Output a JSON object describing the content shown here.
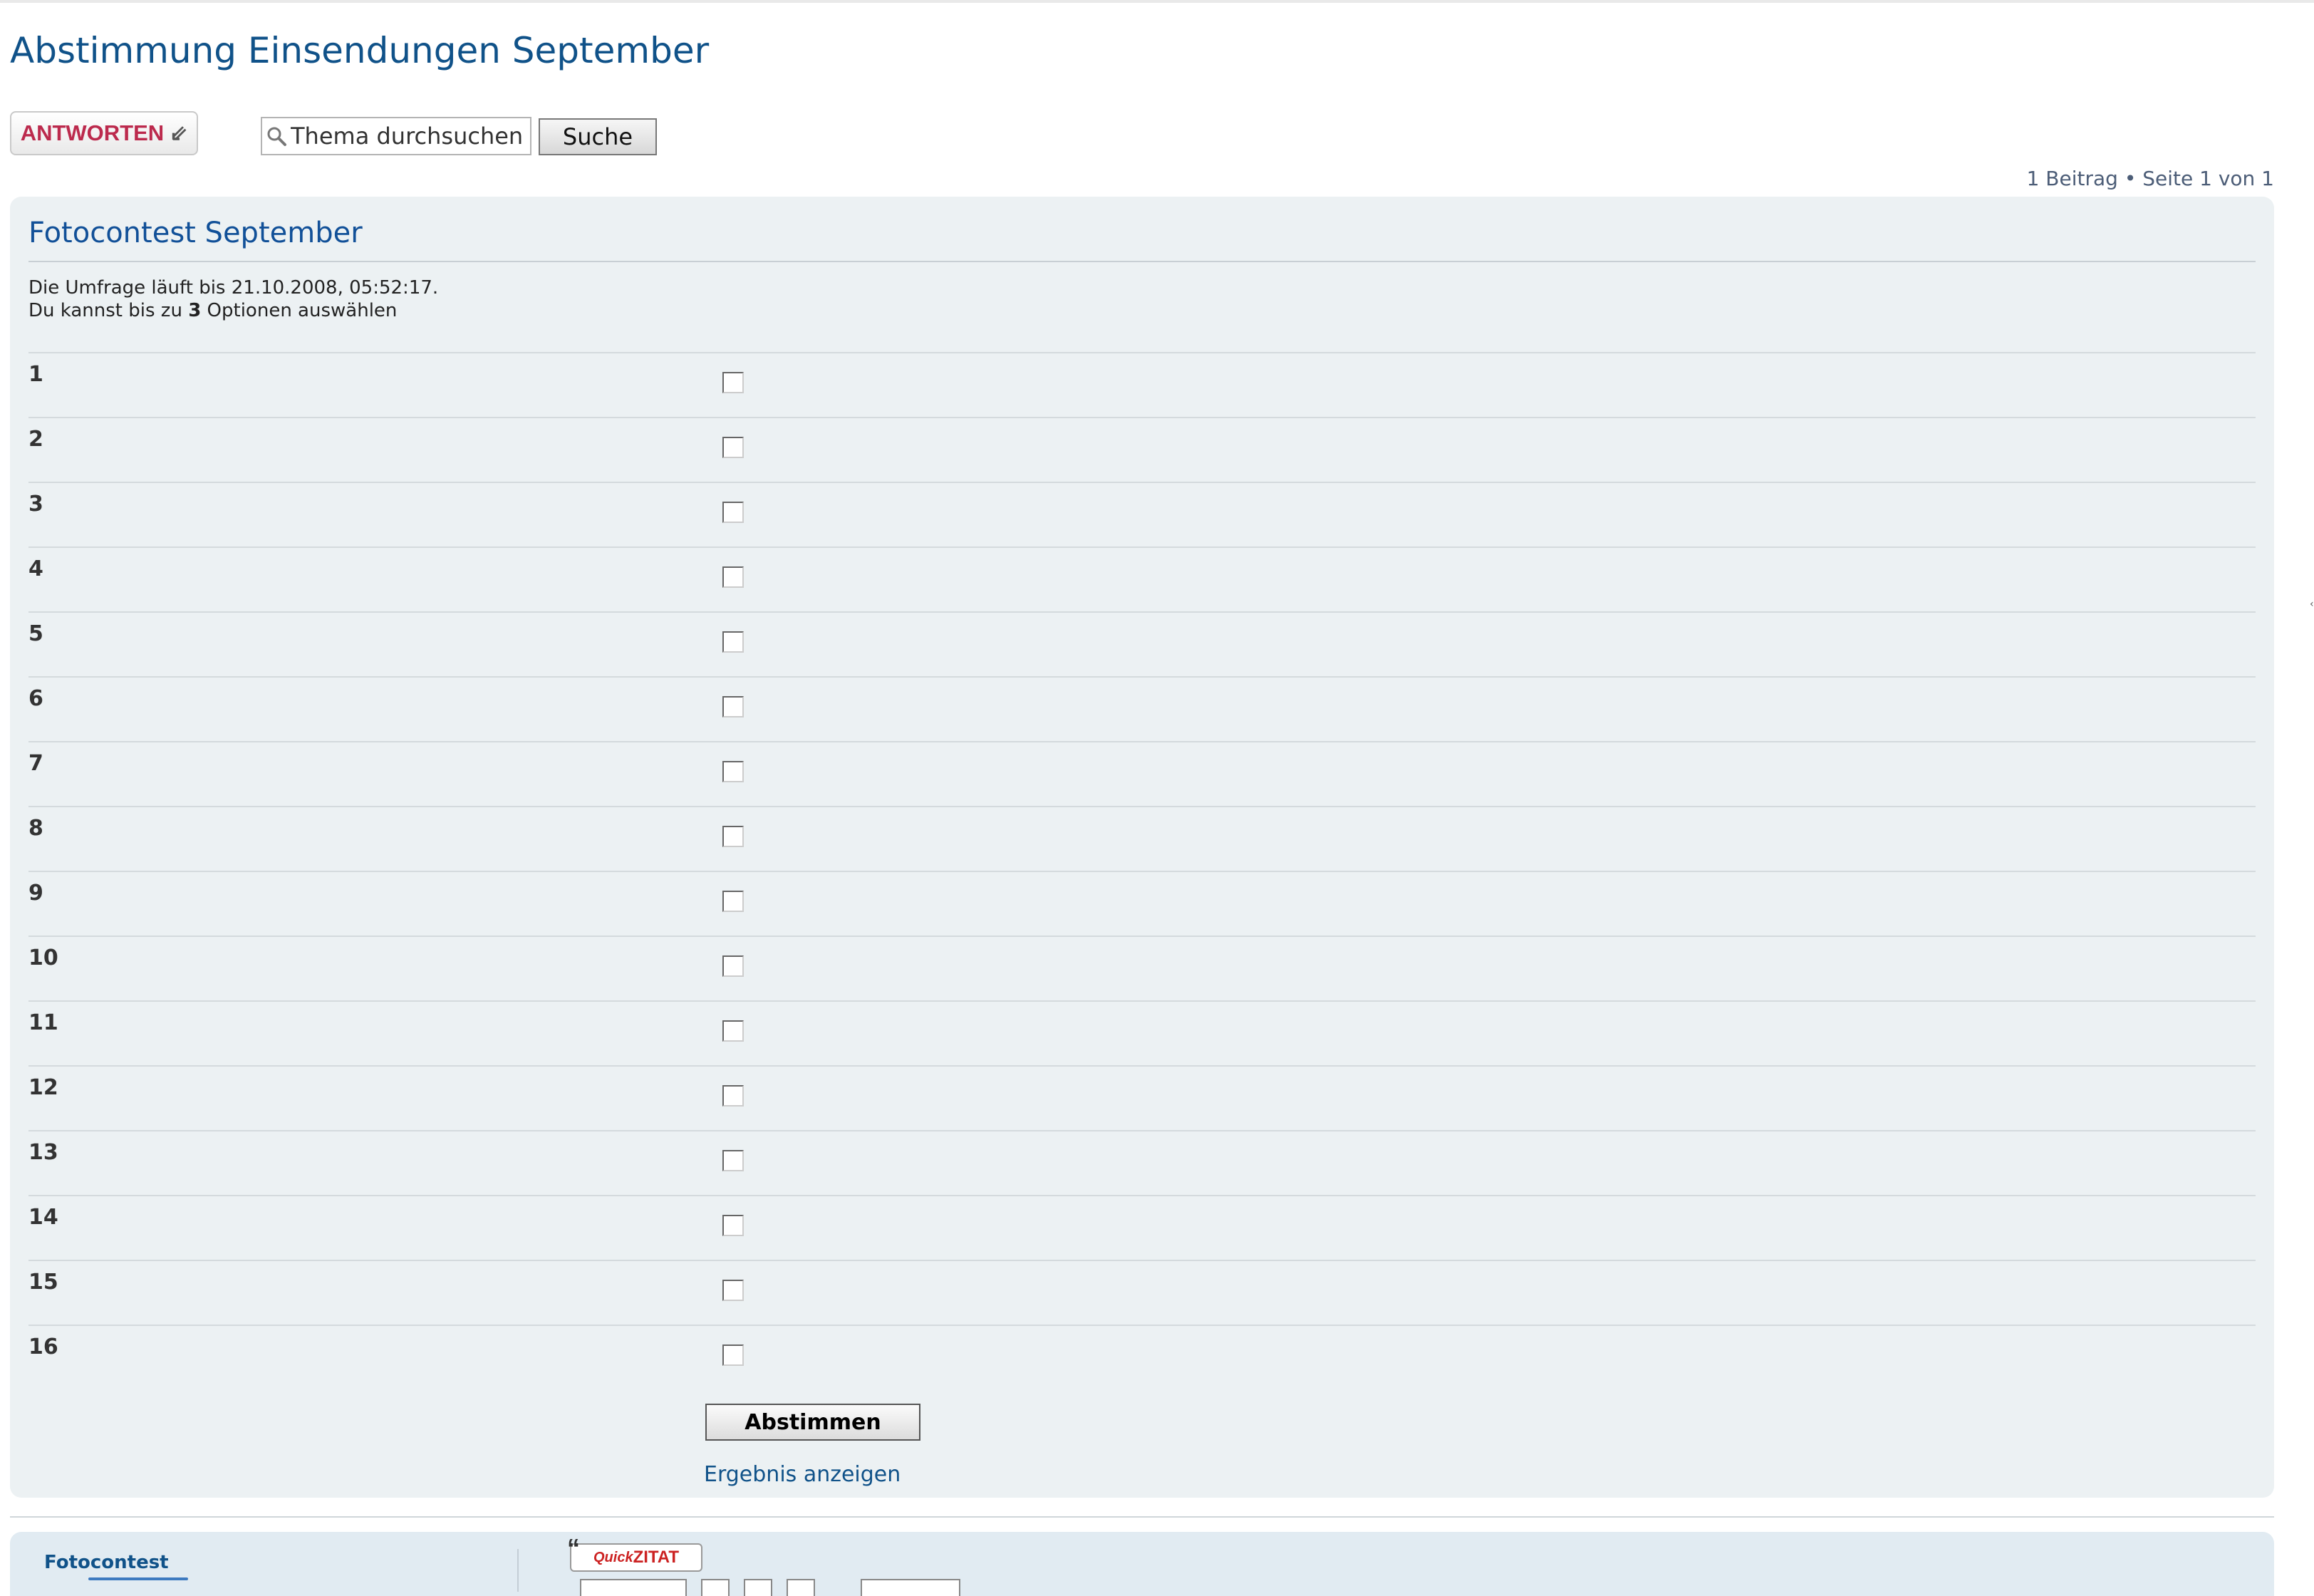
{
  "topic": {
    "title": "Abstimmung Einsendungen September"
  },
  "toolbar": {
    "reply_label": "ANTWORTEN",
    "search_placeholder": "Thema durchsuchen",
    "search_button": "Suche"
  },
  "pagination": {
    "text": "1 Beitrag • Seite 1 von 1"
  },
  "poll": {
    "title": "Fotocontest September",
    "end_prefix": "Die Umfrage läuft bis",
    "end_date": "21.10.2008, 05:52:17.",
    "choice_prefix": "Du kannst bis zu",
    "max_choices": "3",
    "choice_suffix": "Optionen auswählen",
    "options": [
      "1",
      "2",
      "3",
      "4",
      "5",
      "6",
      "7",
      "8",
      "9",
      "10",
      "11",
      "12",
      "13",
      "14",
      "15",
      "16"
    ],
    "vote_button": "Abstimmen",
    "results_link": "Ergebnis anzeigen"
  },
  "post": {
    "author": "Fotocontest",
    "quick_quote_brand": "Quick",
    "quick_quote_label": "ZITAT"
  },
  "colors": {
    "title_blue": "#105289",
    "reply_red": "#bc2a4d",
    "panel_bg": "#ecf1f3",
    "post_bg": "#e1ebf2"
  }
}
